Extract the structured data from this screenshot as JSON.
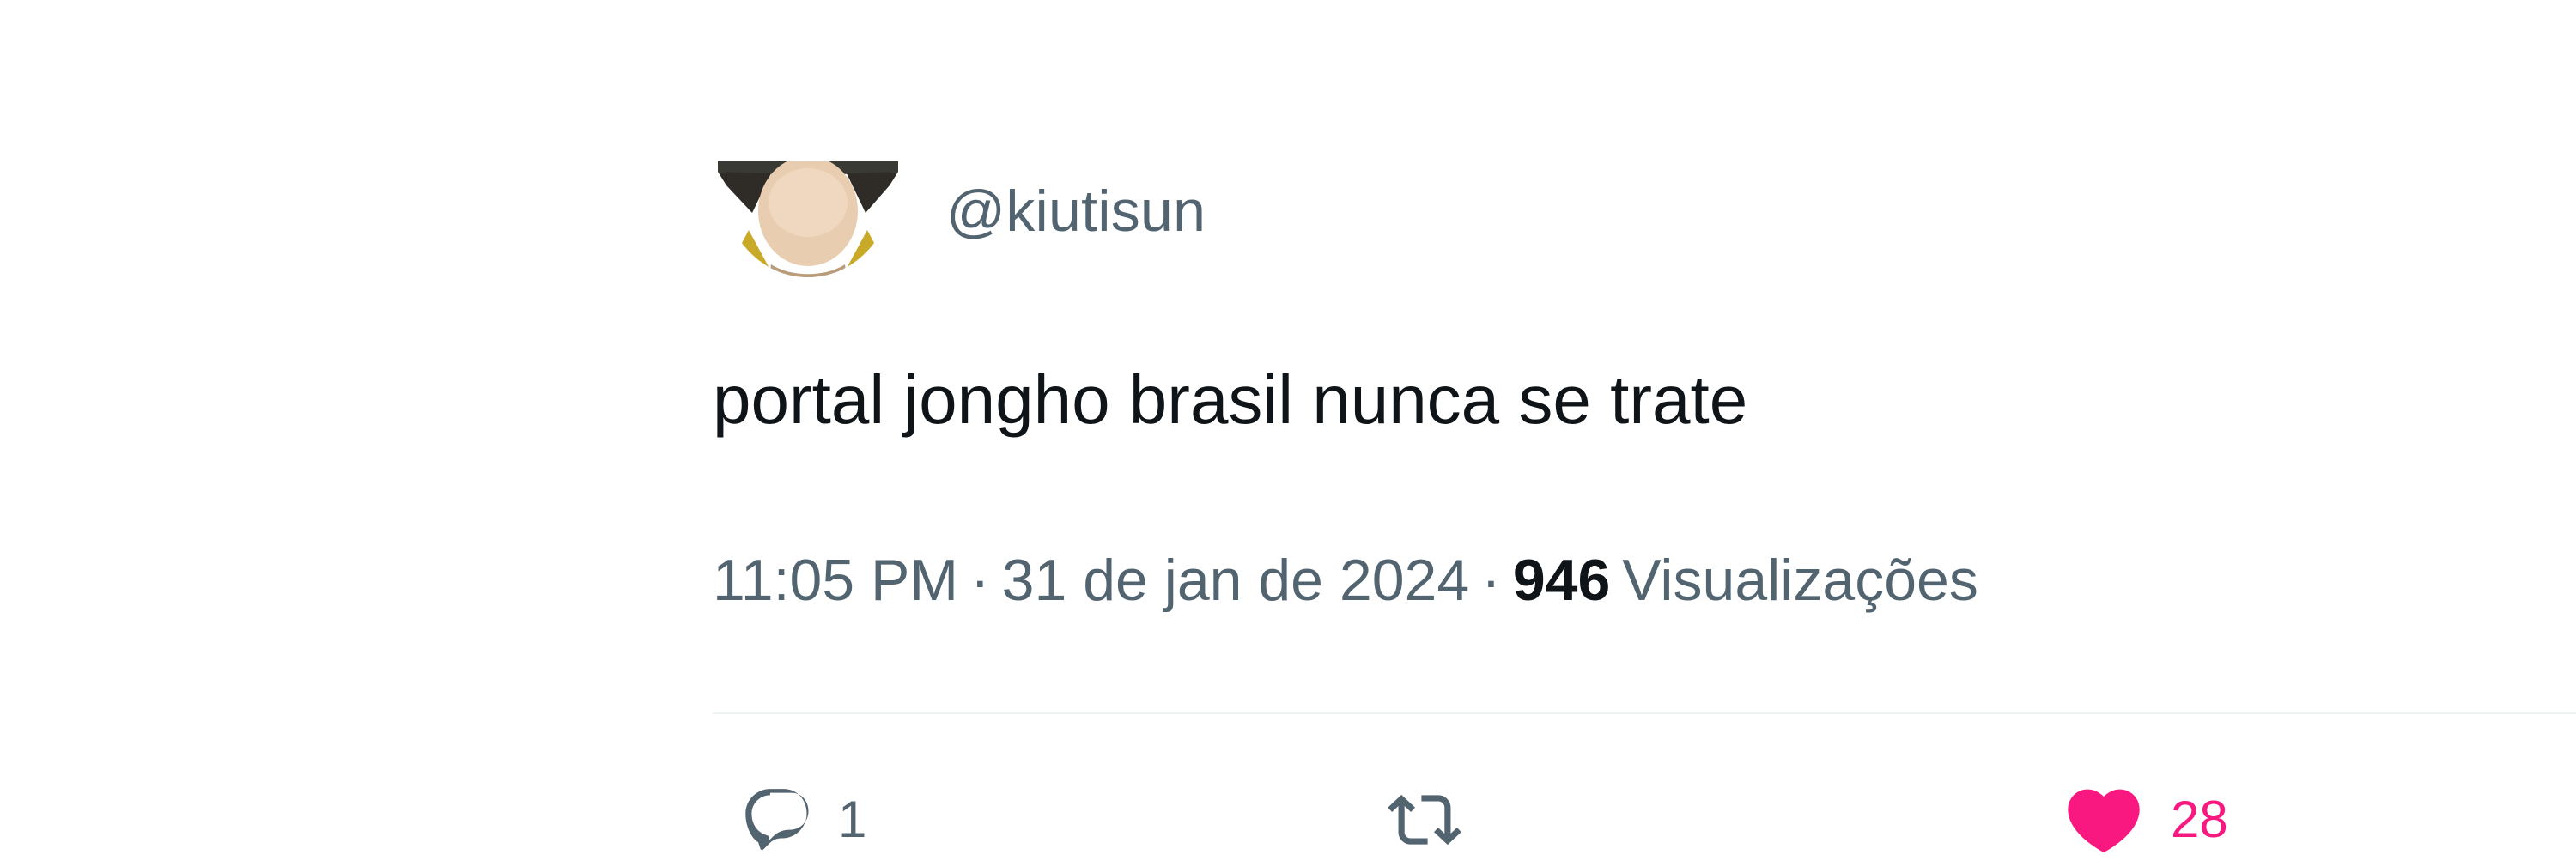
{
  "tweet": {
    "handle": "@kiutisun",
    "text": "portal jongho brasil nunca se trate",
    "time": "11:05 PM",
    "date": "31 de jan de 2024",
    "separator": "·",
    "views_count": "946",
    "views_label": "Visualizações"
  },
  "actions": {
    "reply": {
      "icon": "reply-icon",
      "count": "1"
    },
    "retweet": {
      "icon": "retweet-icon",
      "count": ""
    },
    "like": {
      "icon": "heart-icon",
      "count": "28",
      "color": "#f91880"
    }
  },
  "colors": {
    "text_primary": "#0f1419",
    "text_secondary": "#536471",
    "divider": "#eff3f4",
    "like": "#f91880"
  }
}
